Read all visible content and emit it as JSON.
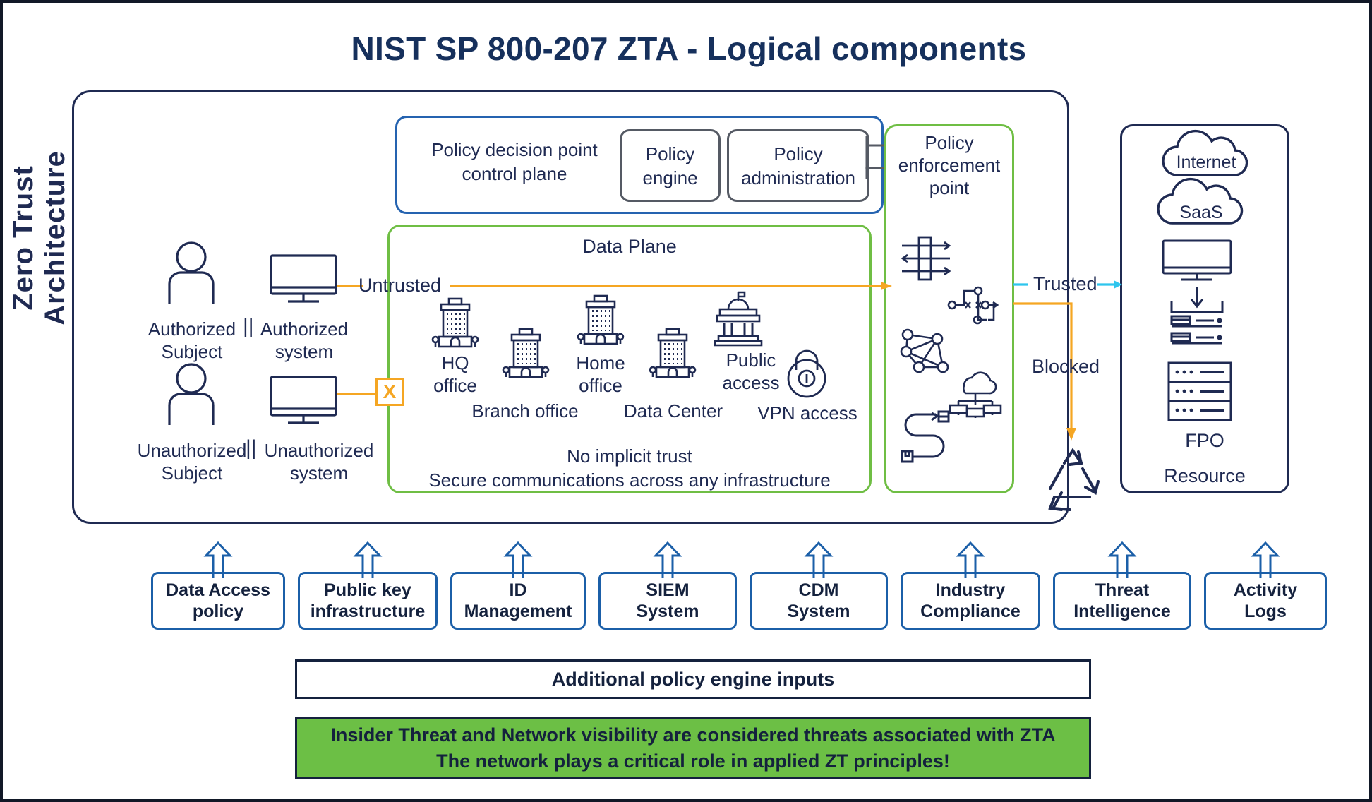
{
  "title": "NIST SP 800-207 ZTA - Logical components",
  "frame": {
    "vertical_label": "Zero Trust Architecture"
  },
  "control_plane": {
    "title": "Policy decision point\ncontrol plane",
    "title_line1": "Policy decision point",
    "title_line2": "control plane",
    "policy_engine_line1": "Policy",
    "policy_engine_line2": "engine",
    "policy_admin_line1": "Policy",
    "policy_admin_line2": "administration",
    "border_color": "#2563b0"
  },
  "data_plane": {
    "title": "Data Plane",
    "footer_line1": "No implicit trust",
    "footer_line2": "Secure communications across any infrastructure",
    "border_color": "#6fbe44",
    "nodes": [
      {
        "label_line1": "HQ",
        "label_line2": "office",
        "icon": "office-building-icon"
      },
      {
        "label_line1": "Branch office",
        "label_line2": "",
        "icon": "office-building-icon"
      },
      {
        "label_line1": "Home",
        "label_line2": "office",
        "icon": "office-building-icon"
      },
      {
        "label_line1": "Data Center",
        "label_line2": "",
        "icon": "office-building-icon"
      },
      {
        "label_line1": "Public",
        "label_line2": "access",
        "icon": "government-building-icon"
      },
      {
        "label_line1": "VPN access",
        "label_line2": "",
        "icon": "padlock-icon"
      }
    ]
  },
  "enforcement_point": {
    "title_line1": "Policy",
    "title_line2": "enforcement",
    "title_line3": "point",
    "border_color": "#6fbe44",
    "icons": [
      "firewall-filter-icon",
      "routing-path-icon",
      "mesh-network-icon",
      "cloud-network-icon",
      "tunnel-path-icon"
    ]
  },
  "resource": {
    "cloud_internet": "Internet",
    "cloud_saas": "SaaS",
    "fpo_label": "FPO",
    "resource_label": "Resource",
    "border_color": "#1f2a52",
    "icons": [
      "cloud-icon",
      "cloud-icon",
      "monitor-icon",
      "download-icon",
      "server-list-icon",
      "server-rack-icon"
    ]
  },
  "subjects": [
    {
      "person_label_line1": "Authorized",
      "person_label_line2": "Subject",
      "separator": "||",
      "system_label_line1": "Authorized",
      "system_label_line2": "system",
      "person_icon": "user-icon",
      "system_icon": "monitor-icon"
    },
    {
      "person_label_line1": "Unauthorized",
      "person_label_line2": "Subject",
      "separator": "||",
      "system_label_line1": "Unauthorized",
      "system_label_line2": "system",
      "person_icon": "user-icon",
      "system_icon": "monitor-icon"
    }
  ],
  "flows": {
    "untrusted": "Untrusted",
    "trusted": "Trusted",
    "blocked": "Blocked",
    "untrusted_color": "#f5a623",
    "trusted_color": "#2ec5ed",
    "blocked_color": "#f5a623",
    "block_marker": "X",
    "recycle_icon": "recycle-icon"
  },
  "inputs": {
    "boxes": [
      {
        "line1": "Data Access",
        "line2": "policy"
      },
      {
        "line1": "Public key",
        "line2": "infrastructure"
      },
      {
        "line1": "ID",
        "line2": "Management"
      },
      {
        "line1": "SIEM",
        "line2": "System"
      },
      {
        "line1": "CDM",
        "line2": "System"
      },
      {
        "line1": "Industry",
        "line2": "Compliance"
      },
      {
        "line1": "Threat",
        "line2": "Intelligence"
      },
      {
        "line1": "Activity",
        "line2": "Logs"
      }
    ],
    "arrow_icon": "up-arrow-icon",
    "border_color": "#1b5fa8"
  },
  "additional_inputs_bar": "Additional policy engine inputs",
  "callout": {
    "line1": "Insider Threat and Network visibility are considered threats associated with ZTA",
    "line2": "The network plays a critical role in applied ZT principles!",
    "background_color": "#6cbf45"
  }
}
